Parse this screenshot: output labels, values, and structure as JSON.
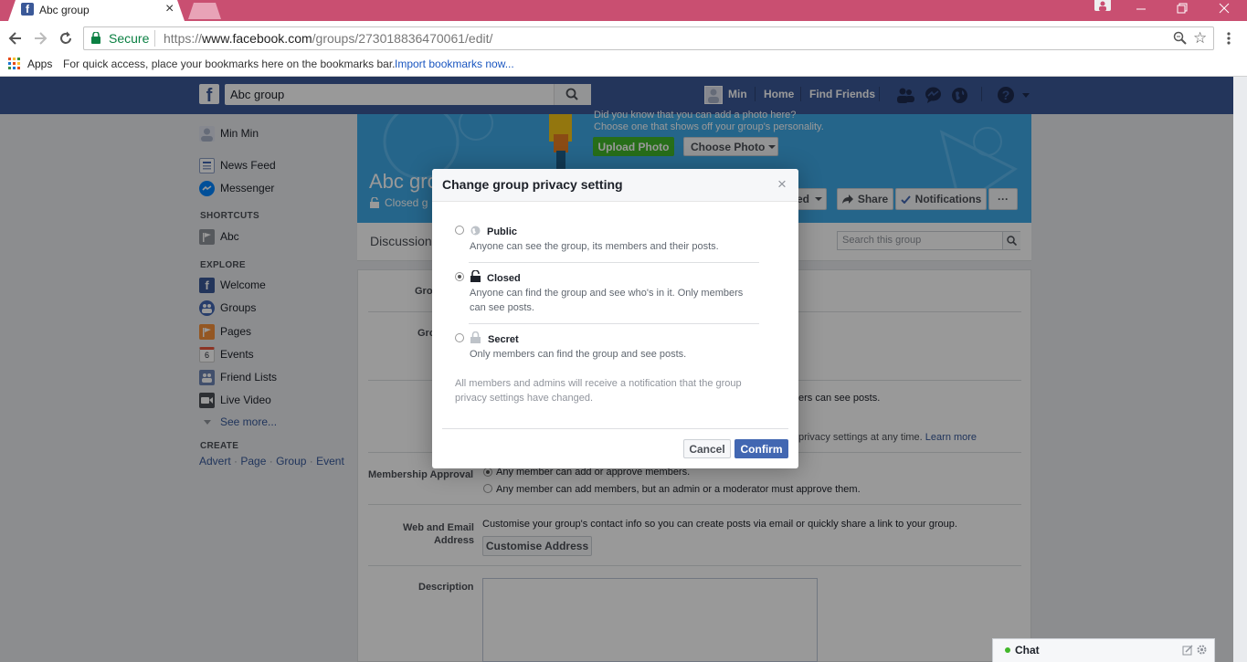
{
  "browser": {
    "tab_title": "Abc group",
    "tab_close": "×",
    "secure_label": "Secure",
    "url_scheme": "https://",
    "url_host": "www.facebook.com",
    "url_path": "/groups/273018836470061/edit/",
    "apps_label": "Apps",
    "bookmarks_hint": "For quick access, place your bookmarks here on the bookmarks bar.",
    "import_link": "Import bookmarks now..."
  },
  "fb": {
    "search_value": "Abc group",
    "user_name": "Min",
    "home": "Home",
    "find_friends": "Find Friends"
  },
  "leftnav": {
    "profile": "Min Min",
    "news_feed": "News Feed",
    "messenger": "Messenger",
    "shortcuts_heading": "SHORTCUTS",
    "shortcut_abc": "Abc",
    "explore_heading": "EXPLORE",
    "welcome": "Welcome",
    "groups": "Groups",
    "pages": "Pages",
    "events": "Events",
    "events_icon_num": "6",
    "friend_lists": "Friend Lists",
    "live_video": "Live Video",
    "see_more": "See more...",
    "create_heading": "CREATE",
    "create_links": [
      "Advert",
      "Page",
      "Group",
      "Event"
    ]
  },
  "cover": {
    "photo_hint_1": "Did you know that you can add a photo here?",
    "photo_hint_2": "Choose one that shows off your group's personality.",
    "upload_photo": "Upload Photo",
    "choose_photo": "Choose Photo",
    "group_title": "Abc gro",
    "closed_label": "Closed g",
    "joined_partial": "ed",
    "share": "Share",
    "notifications": "Notifications",
    "more": "···"
  },
  "tabs": {
    "discussion": "Discussion",
    "search_placeholder": "Search this group"
  },
  "settings": {
    "group_name_label": "Gro",
    "group_type_label": "Gro",
    "privacy_partial": "ers can see posts.",
    "privacy_change_note": "privacy settings at any time.",
    "learn_more": "Learn more",
    "membership_label": "Membership Approval",
    "membership_opt1": "Any member can add or approve members.",
    "membership_opt2": "Any member can add members, but an admin or a moderator must approve them.",
    "web_email_label_1": "Web and Email",
    "web_email_label_2": "Address",
    "web_email_text": "Customise your group's contact info so you can create posts via email or quickly share a link to your group.",
    "customise_address": "Customise Address",
    "description_label": "Description"
  },
  "dialog": {
    "title": "Change group privacy setting",
    "close": "×",
    "options": [
      {
        "label": "Public",
        "desc": "Anyone can see the group, its members and their posts.",
        "selected": false
      },
      {
        "label": "Closed",
        "desc": "Anyone can find the group and see who's in it. Only members can see posts.",
        "selected": true
      },
      {
        "label": "Secret",
        "desc": "Only members can find the group and see posts.",
        "selected": false
      }
    ],
    "notice": "All members and admins will receive a notification that the group privacy settings have changed.",
    "cancel": "Cancel",
    "confirm": "Confirm"
  },
  "chat": {
    "label": "Chat"
  },
  "colors": {
    "titlebar": "#c94f71",
    "fb_blue": "#3b5998",
    "confirm_blue": "#4267b2",
    "upload_green": "#42b72a",
    "cover_blue": "#3fa9e6"
  }
}
